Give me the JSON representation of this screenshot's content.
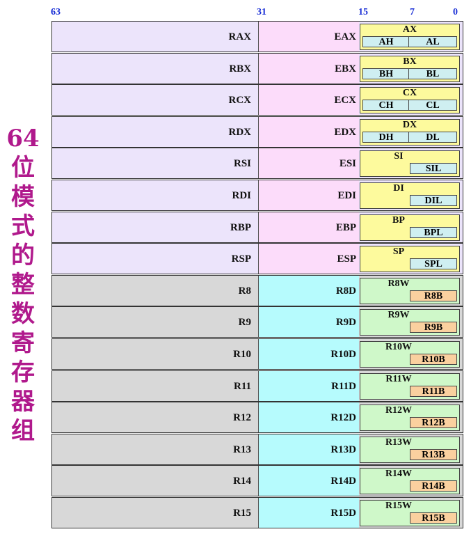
{
  "title_chars": [
    "64",
    "位",
    "模",
    "式",
    "的",
    "整",
    "数",
    "寄",
    "存",
    "器",
    "组"
  ],
  "bit_labels": {
    "b63": "63",
    "b31": "31",
    "b15": "15",
    "b7": "7",
    "b0": "0"
  },
  "rows": [
    {
      "r64": "RAX",
      "r32": "EAX",
      "r16": "AX",
      "high": "AH",
      "low": "AL"
    },
    {
      "r64": "RBX",
      "r32": "EBX",
      "r16": "BX",
      "high": "BH",
      "low": "BL"
    },
    {
      "r64": "RCX",
      "r32": "ECX",
      "r16": "CX",
      "high": "CH",
      "low": "CL"
    },
    {
      "r64": "RDX",
      "r32": "EDX",
      "r16": "DX",
      "high": "DH",
      "low": "DL"
    },
    {
      "r64": "RSI",
      "r32": "ESI",
      "r16": "SI",
      "low": "SIL"
    },
    {
      "r64": "RDI",
      "r32": "EDI",
      "r16": "DI",
      "low": "DIL"
    },
    {
      "r64": "RBP",
      "r32": "EBP",
      "r16": "BP",
      "low": "BPL"
    },
    {
      "r64": "RSP",
      "r32": "ESP",
      "r16": "SP",
      "low": "SPL"
    },
    {
      "r64": "R8",
      "r32": "R8D",
      "r16": "R8W",
      "low": "R8B"
    },
    {
      "r64": "R9",
      "r32": "R9D",
      "r16": "R9W",
      "low": "R9B"
    },
    {
      "r64": "R10",
      "r32": "R10D",
      "r16": "R10W",
      "low": "R10B"
    },
    {
      "r64": "R11",
      "r32": "R11D",
      "r16": "R11W",
      "low": "R11B"
    },
    {
      "r64": "R12",
      "r32": "R12D",
      "r16": "R12W",
      "low": "R12B"
    },
    {
      "r64": "R13",
      "r32": "R13D",
      "r16": "R13W",
      "low": "R13B"
    },
    {
      "r64": "R14",
      "r32": "R14D",
      "r16": "R14W",
      "low": "R14B"
    },
    {
      "r64": "R15",
      "r32": "R15D",
      "r16": "R15W",
      "low": "R15B"
    }
  ],
  "colors": {
    "title": "#b0198c",
    "bits": "#1a2fd6"
  }
}
